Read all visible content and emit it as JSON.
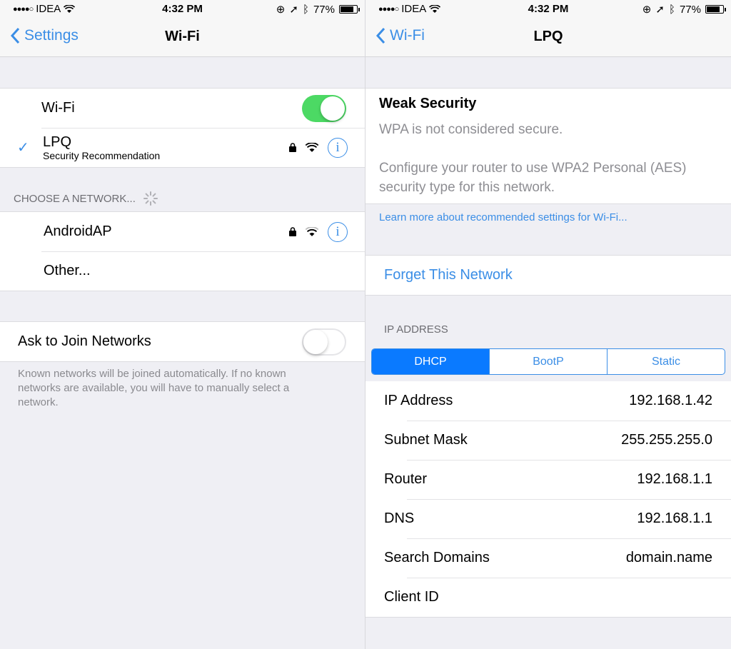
{
  "status_bar": {
    "carrier": "IDEA",
    "signal_dots": "●●●●○",
    "time": "4:32 PM",
    "battery_percent": "77%",
    "battery_level": 0.77
  },
  "left": {
    "nav": {
      "back_label": "Settings",
      "title": "Wi-Fi"
    },
    "wifi_row": {
      "label": "Wi-Fi",
      "toggle_on": true
    },
    "connected": {
      "name": "LPQ",
      "subtitle": "Security Recommendation",
      "check": "✓",
      "secured": true
    },
    "choose_header": "CHOOSE A NETWORK...",
    "networks": [
      {
        "name": "AndroidAP",
        "secured": true
      },
      {
        "name": "Other..."
      }
    ],
    "ask_to_join": {
      "label": "Ask to Join Networks",
      "toggle_on": false
    },
    "ask_footer": "Known networks will be joined automatically. If no known networks are available, you will have to manually select a network."
  },
  "right": {
    "nav": {
      "back_label": "Wi-Fi",
      "title": "LPQ"
    },
    "security": {
      "title": "Weak Security",
      "line1": "WPA is not considered secure.",
      "line2": "Configure your router to use WPA2 Personal (AES) security type for this network."
    },
    "learn_more": "Learn more about recommended settings for Wi-Fi...",
    "forget_label": "Forget This Network",
    "ip_header": "IP ADDRESS",
    "segments": [
      {
        "label": "DHCP",
        "active": true
      },
      {
        "label": "BootP",
        "active": false
      },
      {
        "label": "Static",
        "active": false
      }
    ],
    "fields": [
      {
        "label": "IP Address",
        "value": "192.168.1.42"
      },
      {
        "label": "Subnet Mask",
        "value": "255.255.255.0"
      },
      {
        "label": "Router",
        "value": "192.168.1.1"
      },
      {
        "label": "DNS",
        "value": "192.168.1.1"
      },
      {
        "label": "Search Domains",
        "value": "domain.name"
      },
      {
        "label": "Client ID",
        "value": ""
      }
    ]
  },
  "colors": {
    "accent": "#3b8ee6",
    "toggle_on": "#4cd964",
    "segment_active": "#0a7aff",
    "background": "#efeff4"
  }
}
